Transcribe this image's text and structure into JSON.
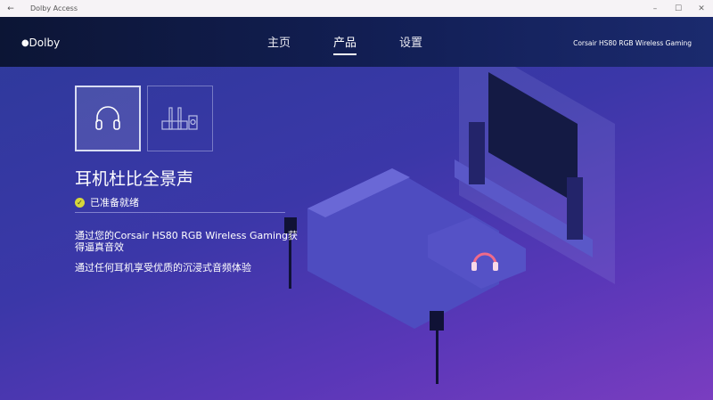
{
  "window": {
    "title": "Dolby Access",
    "back": "←",
    "minimize": "–",
    "maximize": "☐",
    "close": "✕"
  },
  "header": {
    "logo": "Dolby",
    "nav": [
      {
        "label": "主页"
      },
      {
        "label": "产品"
      },
      {
        "label": "设置"
      }
    ],
    "device": "Corsair HS80 RGB Wireless Gaming"
  },
  "main": {
    "title": "耳机杜比全景声",
    "status": "已准备就绪",
    "desc1": "通过您的Corsair HS80 RGB Wireless Gaming获得逼真音效",
    "desc2": "通过任何耳机享受优质的沉浸式音频体验"
  },
  "colors": {
    "accent": "#d6d63a"
  }
}
